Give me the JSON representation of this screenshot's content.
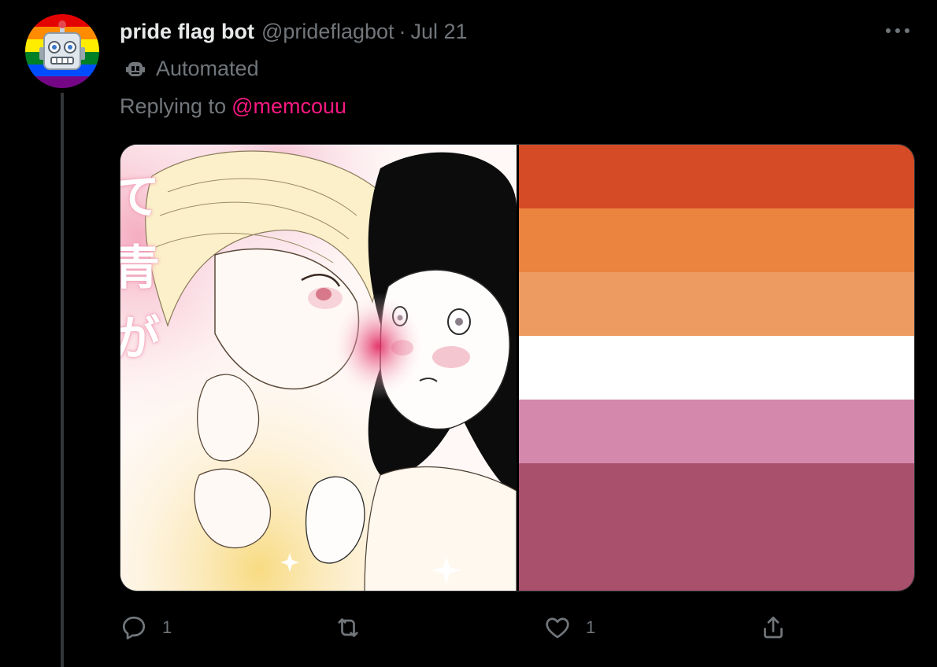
{
  "tweet": {
    "display_name": "pride flag bot",
    "handle": "@prideflagbot",
    "separator": "·",
    "date": "Jul 21",
    "automated_label": "Automated",
    "reply_prefix": "Replying to",
    "reply_mention": "@memcouu",
    "avatar_icon": "robot-face-icon",
    "more_icon": "more-options-icon",
    "automated_icon": "robot-icon"
  },
  "media": {
    "left_image": "manga-illustration",
    "artwork_text": [
      "て",
      "青",
      "が"
    ],
    "flag_name": "lesbian-flag",
    "flag_stripes": [
      "#d44b25",
      "#eb843f",
      "#ee9b61",
      "#ffffff",
      "#d488ab",
      "#a9506d",
      "#a9506d"
    ]
  },
  "actions": {
    "reply": {
      "icon": "reply-icon",
      "count": "1"
    },
    "retweet": {
      "icon": "retweet-icon",
      "count": ""
    },
    "like": {
      "icon": "heart-icon",
      "count": "1"
    },
    "share": {
      "icon": "share-icon"
    }
  },
  "colors": {
    "background": "#000000",
    "primary_text": "#e7e9ea",
    "secondary_text": "#71767b",
    "mention": "#f91880",
    "thread_line": "#333639"
  }
}
